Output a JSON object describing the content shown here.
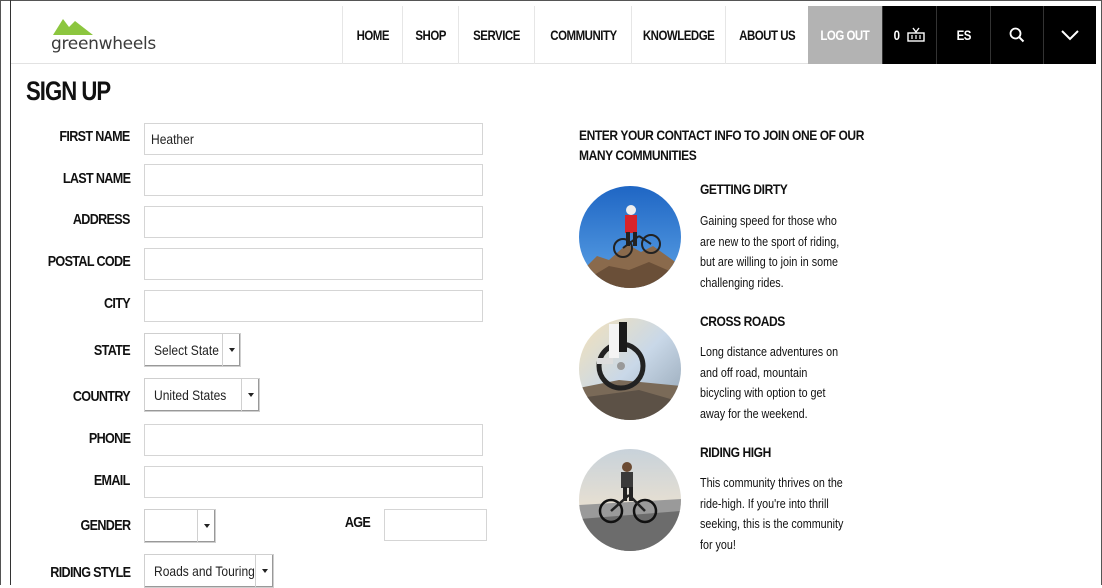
{
  "brand": {
    "name": "greenwheels",
    "accent": "#8cc63f"
  },
  "nav": {
    "home": "HOME",
    "shop": "SHOP",
    "service": "SERVICE",
    "community": "COMMUNITY",
    "knowledge": "KNOWLEDGE",
    "about": "ABOUT US",
    "logout": "LOG OUT",
    "cart_count": "0",
    "language": "ES",
    "icons": {
      "cart": "basket-icon",
      "search": "search-icon",
      "menu": "chevron-down-icon"
    }
  },
  "form": {
    "title": "SIGN UP",
    "first_name": {
      "label": "FIRST NAME",
      "value": "Heather"
    },
    "last_name": {
      "label": "LAST NAME",
      "value": ""
    },
    "address": {
      "label": "ADDRESS",
      "value": ""
    },
    "postal_code": {
      "label": "POSTAL CODE",
      "value": ""
    },
    "city": {
      "label": "CITY",
      "value": ""
    },
    "state": {
      "label": "STATE",
      "value": "Select State"
    },
    "country": {
      "label": "COUNTRY",
      "value": "United States"
    },
    "phone": {
      "label": "PHONE",
      "value": ""
    },
    "email": {
      "label": "EMAIL",
      "value": ""
    },
    "gender": {
      "label": "GENDER",
      "value": ""
    },
    "age": {
      "label": "AGE",
      "value": ""
    },
    "riding_style": {
      "label": "RIDING STYLE",
      "value": "Roads and Touring"
    }
  },
  "communities": {
    "intro": "ENTER YOUR CONTACT INFO TO JOIN ONE OF OUR MANY COMMUNITIES",
    "items": [
      {
        "title": "GETTING DIRTY",
        "desc": "Gaining speed for those who are new to the sport of riding, but are willing to join in some challenging rides."
      },
      {
        "title": "CROSS ROADS",
        "desc": "Long distance adventures on and off road, mountain bicycling with option to get away for the weekend."
      },
      {
        "title": "RIDING HIGH",
        "desc": "This community thrives on the ride-high.  If you're into thrill seeking, this is the community for you!"
      }
    ]
  }
}
